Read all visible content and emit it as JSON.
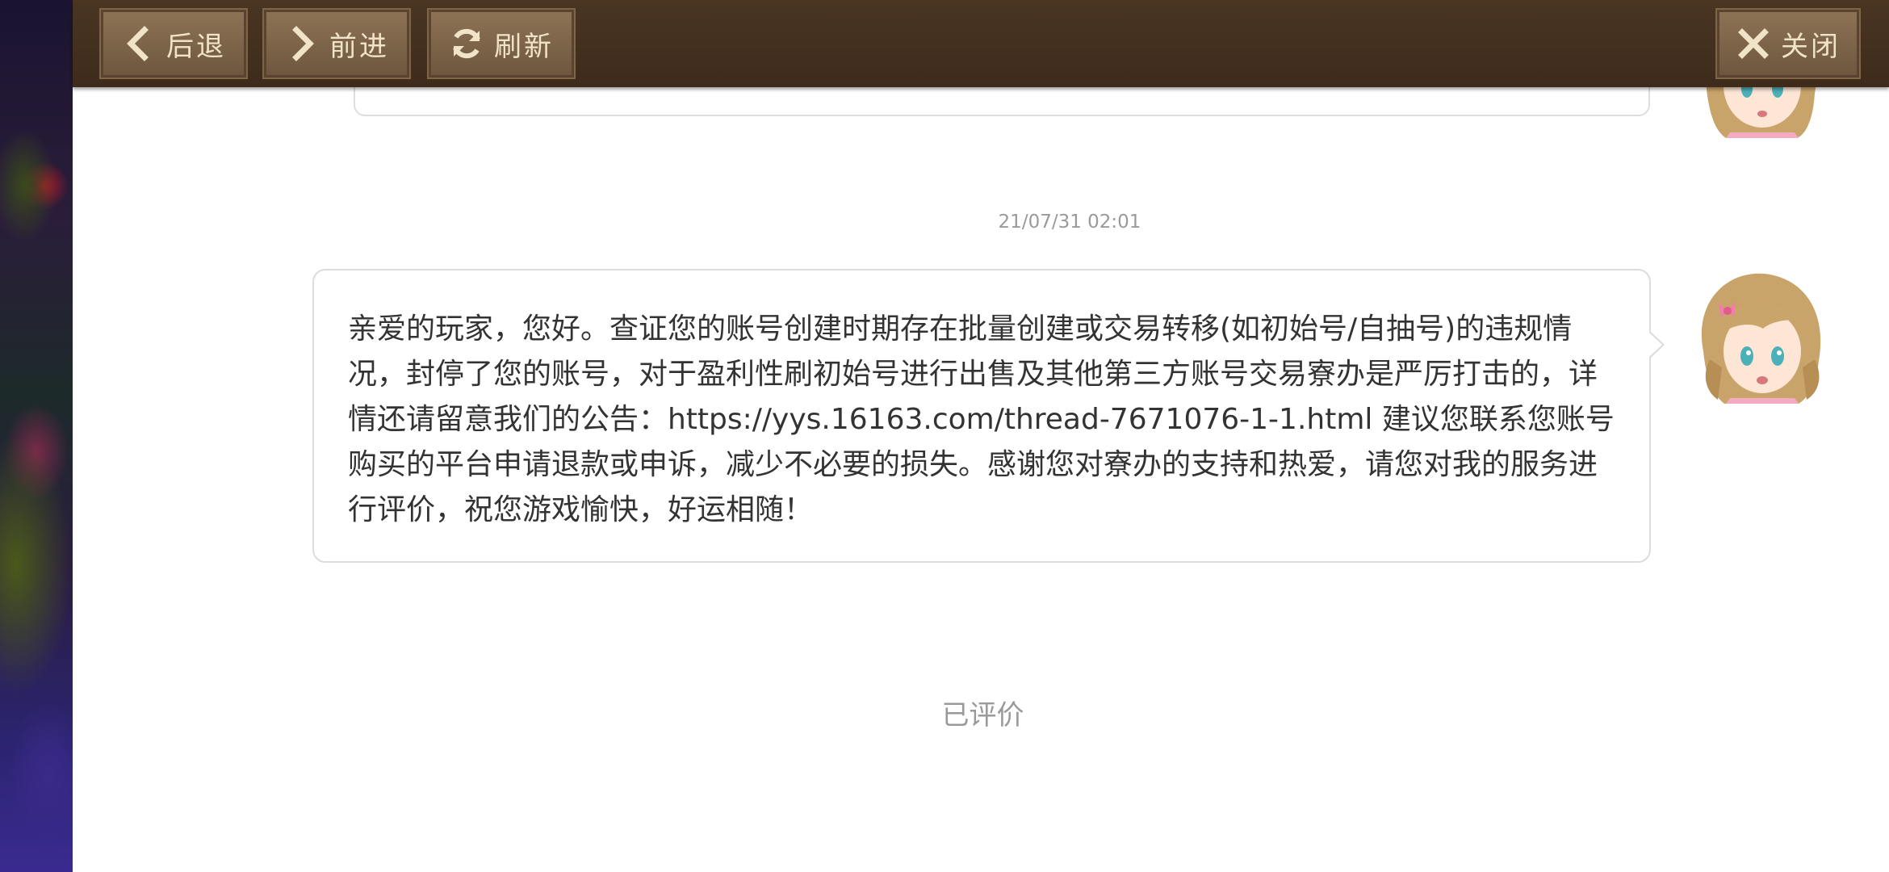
{
  "toolbar": {
    "back_label": "后退",
    "forward_label": "前进",
    "refresh_label": "刷新",
    "close_label": "关闭",
    "icons": {
      "back": "chevron-left-icon",
      "forward": "chevron-right-icon",
      "refresh": "refresh-icon",
      "close": "close-icon"
    }
  },
  "chat": {
    "timestamp": "21/07/31 02:01",
    "message": "亲爱的玩家，您好。查证您的账号创建时期存在批量创建或交易转移(如初始号/自抽号)的违规情况，封停了您的账号，对于盈利性刷初始号进行出售及其他第三方账号交易寮办是严厉打击的，详情还请留意我们的公告：https://yys.16163.com/thread-7671076-1-1.html  建议您联系您账号购买的平台申请退款或申诉，减少不必要的损失。感谢您对寮办的支持和热爱，请您对我的服务进行评价，祝您游戏愉快，好运相随！",
    "rated_status": "已评价"
  },
  "colors": {
    "toolbar_bg": "#3e2b1b",
    "button_bg": "#7e6548",
    "button_text": "#f1e3c8",
    "bubble_border": "#dcdcdc",
    "muted_text": "#9a9a9a"
  }
}
